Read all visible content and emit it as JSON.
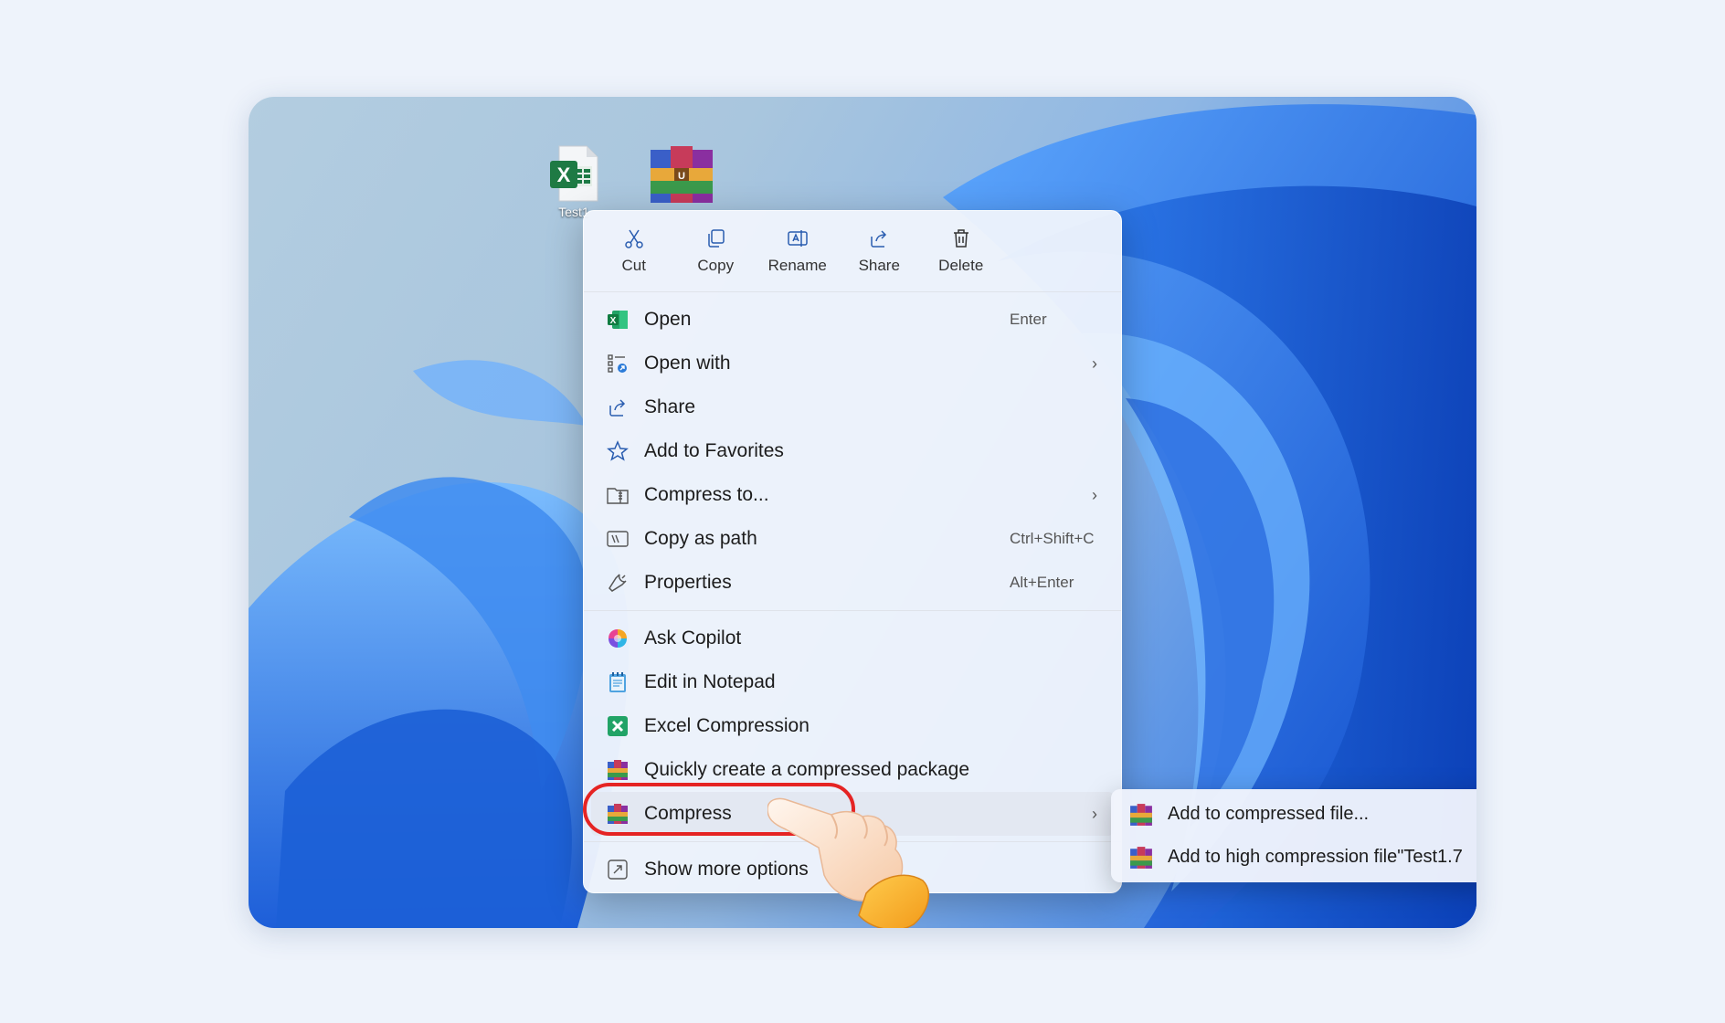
{
  "desktop": {
    "icons": [
      {
        "label": "Test1",
        "type": "excel-file-icon"
      },
      {
        "label": "",
        "type": "winrar-icon"
      }
    ]
  },
  "toolbar": {
    "cut": "Cut",
    "copy": "Copy",
    "rename": "Rename",
    "share": "Share",
    "delete": "Delete"
  },
  "menu": {
    "items": [
      {
        "label": "Open",
        "shortcut": "Enter",
        "icon": "excel-icon"
      },
      {
        "label": "Open with",
        "submenu": true,
        "icon": "open-with-icon"
      },
      {
        "label": "Share",
        "icon": "share-icon"
      },
      {
        "label": "Add to Favorites",
        "icon": "star-icon"
      },
      {
        "label": "Compress to...",
        "submenu": true,
        "icon": "compress-folder-icon"
      },
      {
        "label": "Copy as path",
        "shortcut": "Ctrl+Shift+C",
        "icon": "copy-path-icon"
      },
      {
        "label": "Properties",
        "shortcut": "Alt+Enter",
        "icon": "wrench-icon"
      }
    ],
    "extra_items": [
      {
        "label": "Ask Copilot",
        "icon": "copilot-icon"
      },
      {
        "label": "Edit in Notepad",
        "icon": "notepad-icon"
      },
      {
        "label": "Excel Compression",
        "icon": "excel-compression-icon"
      },
      {
        "label": "Quickly create a compressed package",
        "icon": "winrar-icon"
      },
      {
        "label": "Compress",
        "submenu": true,
        "icon": "winrar-icon"
      }
    ],
    "more": {
      "label": "Show more options",
      "icon": "more-options-icon"
    }
  },
  "submenu": {
    "items": [
      {
        "label": "Add to compressed file...",
        "icon": "winrar-icon"
      },
      {
        "label": "Add to high compression file\"Test1.7",
        "icon": "winrar-icon"
      }
    ]
  },
  "colors": {
    "highlight_ring": "#e52424",
    "accent": "#1f6fd9"
  }
}
